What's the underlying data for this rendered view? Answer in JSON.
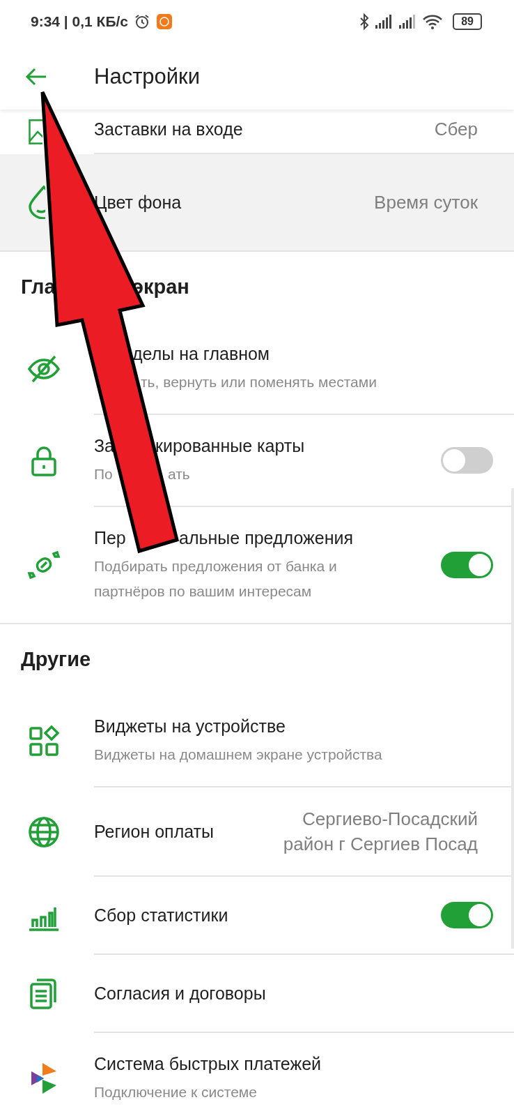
{
  "status_bar": {
    "text": "9:34 | 0,1 КБ/с",
    "battery": "89"
  },
  "app_bar": {
    "title": "Настройки"
  },
  "sections": [
    {
      "items": [
        {
          "kind": "value",
          "selected": false,
          "title_parts": [
            "Заставки на входе"
          ],
          "value": "Сбер"
        },
        {
          "kind": "value",
          "selected": true,
          "title_parts": [
            "Цвет фона"
          ],
          "value": "Время суток"
        }
      ]
    },
    {
      "heading_parts": [
        "Гла",
        "экран"
      ],
      "items": [
        {
          "kind": "plain",
          "selected": false,
          "title_parts": [
            "делы на главном"
          ],
          "subtitle_parts": [
            "ть, вернуть или поменять местами"
          ]
        },
        {
          "kind": "toggle",
          "selected": false,
          "on": false,
          "title_parts": [
            "За",
            "кированные карты"
          ],
          "subtitle_parts": [
            "По",
            "ать"
          ]
        },
        {
          "kind": "toggle",
          "selected": false,
          "on": true,
          "title_parts": [
            "Пер",
            "альные предложения"
          ],
          "subtitle_parts": [
            "Подбирать предложения от банка и партнёров по вашим интересам"
          ]
        }
      ]
    },
    {
      "heading_parts": [
        "Другие"
      ],
      "items": [
        {
          "kind": "plain",
          "selected": false,
          "title_parts": [
            "Виджеты на устройстве"
          ],
          "subtitle_parts": [
            "Виджеты на домашнем экране устройства"
          ]
        },
        {
          "kind": "value",
          "selected": false,
          "title_parts": [
            "Регион оплаты"
          ],
          "value": "Сергиево-Посадский район г Сергиев Посад"
        },
        {
          "kind": "toggle",
          "selected": false,
          "on": true,
          "title_parts": [
            "Сбор статистики"
          ]
        },
        {
          "kind": "plain",
          "selected": false,
          "title_parts": [
            "Согласия и договоры"
          ]
        },
        {
          "kind": "plain",
          "selected": false,
          "title_parts": [
            "Система быстрых платежей"
          ],
          "subtitle_parts": [
            "Подключение к системе"
          ]
        }
      ]
    }
  ]
}
